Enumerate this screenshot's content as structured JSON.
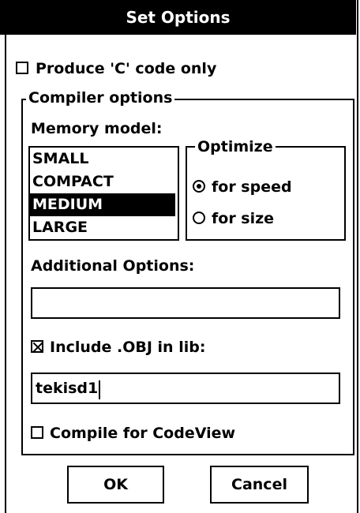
{
  "dialog": {
    "title": "Set Options"
  },
  "produce_c_code": {
    "label": "Produce 'C' code only",
    "checked": false
  },
  "compiler_options": {
    "legend": "Compiler options",
    "memory_model": {
      "label": "Memory model:",
      "items": [
        "SMALL",
        "COMPACT",
        "MEDIUM",
        "LARGE"
      ],
      "selected": "MEDIUM"
    },
    "optimize": {
      "legend": "Optimize",
      "speed_label": "for speed",
      "size_label": "for size",
      "selected": "for speed"
    },
    "additional_options": {
      "label": "Additional Options:",
      "value": ""
    },
    "include_obj": {
      "label": "Include .OBJ in lib:",
      "checked": true,
      "value": "tekisd1"
    },
    "codeview": {
      "label": "Compile for CodeView",
      "checked": false
    }
  },
  "buttons": {
    "ok": "OK",
    "cancel": "Cancel"
  }
}
